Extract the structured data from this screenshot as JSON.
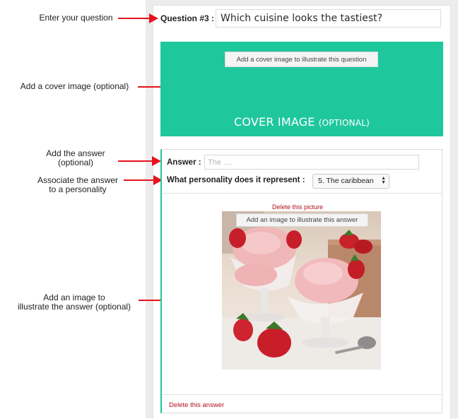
{
  "annotations": {
    "enter_question": "Enter your question",
    "cover_image": "Add a cover image (optional)",
    "answer_line1": "Add the answer",
    "answer_line2": "(optional)",
    "personality_line1": "Associate the answer",
    "personality_line2": "to a personality",
    "image_line1": "Add an image to",
    "image_line2": "illustrate the answer (optional)"
  },
  "question": {
    "label": "Question #3 :",
    "value": "Which cuisine looks the tastiest?"
  },
  "cover": {
    "button_label": "Add a cover image to illustrate this question",
    "title_main": "Cover image",
    "title_optional": "(optional)"
  },
  "answer": {
    "label": "Answer :",
    "placeholder": "The ....",
    "personality_label": "What personality does it represent :",
    "personality_selected": "5. The caribbean",
    "delete_picture": "Delete this picture",
    "image_button_label": "Add an image to illustrate this answer",
    "delete_answer": "Delete this answer"
  },
  "colors": {
    "accent_green": "#1fc79d",
    "arrow_red": "#e8121c",
    "delete_red": "#b1121c"
  }
}
